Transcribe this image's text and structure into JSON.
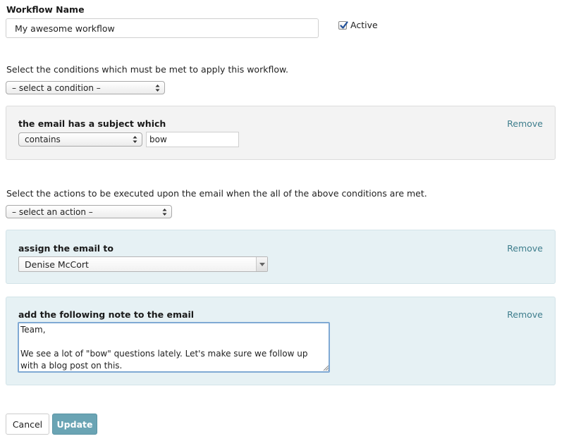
{
  "workflow": {
    "name_label": "Workflow Name",
    "name_value": "My awesome workflow",
    "active_label": "Active",
    "active_checked": true
  },
  "conditions": {
    "instruction": "Select the conditions which must be met to apply this workflow.",
    "select_value": "– select a condition –",
    "items": [
      {
        "title": "the email has a subject which",
        "operator": "contains",
        "value": "bow",
        "remove_label": "Remove"
      }
    ]
  },
  "actions": {
    "instruction": "Select the actions to be executed upon the email when the all of the above conditions are met.",
    "select_value": "– select an action –",
    "assign": {
      "title": "assign the email to",
      "assignee": "Denise McCort",
      "remove_label": "Remove"
    },
    "note": {
      "title": "add the following note to the email",
      "text": "Team,\n\nWe see a lot of \"bow\" questions lately. Let's make sure we follow up with a blog post on this.",
      "remove_label": "Remove"
    }
  },
  "buttons": {
    "cancel_label": "Cancel",
    "update_label": "Update"
  },
  "colors": {
    "accent": "#6aa4b4",
    "link": "#3d7d8c",
    "condition_panel": "#f3f3f3",
    "action_panel": "#e6f1f4"
  }
}
